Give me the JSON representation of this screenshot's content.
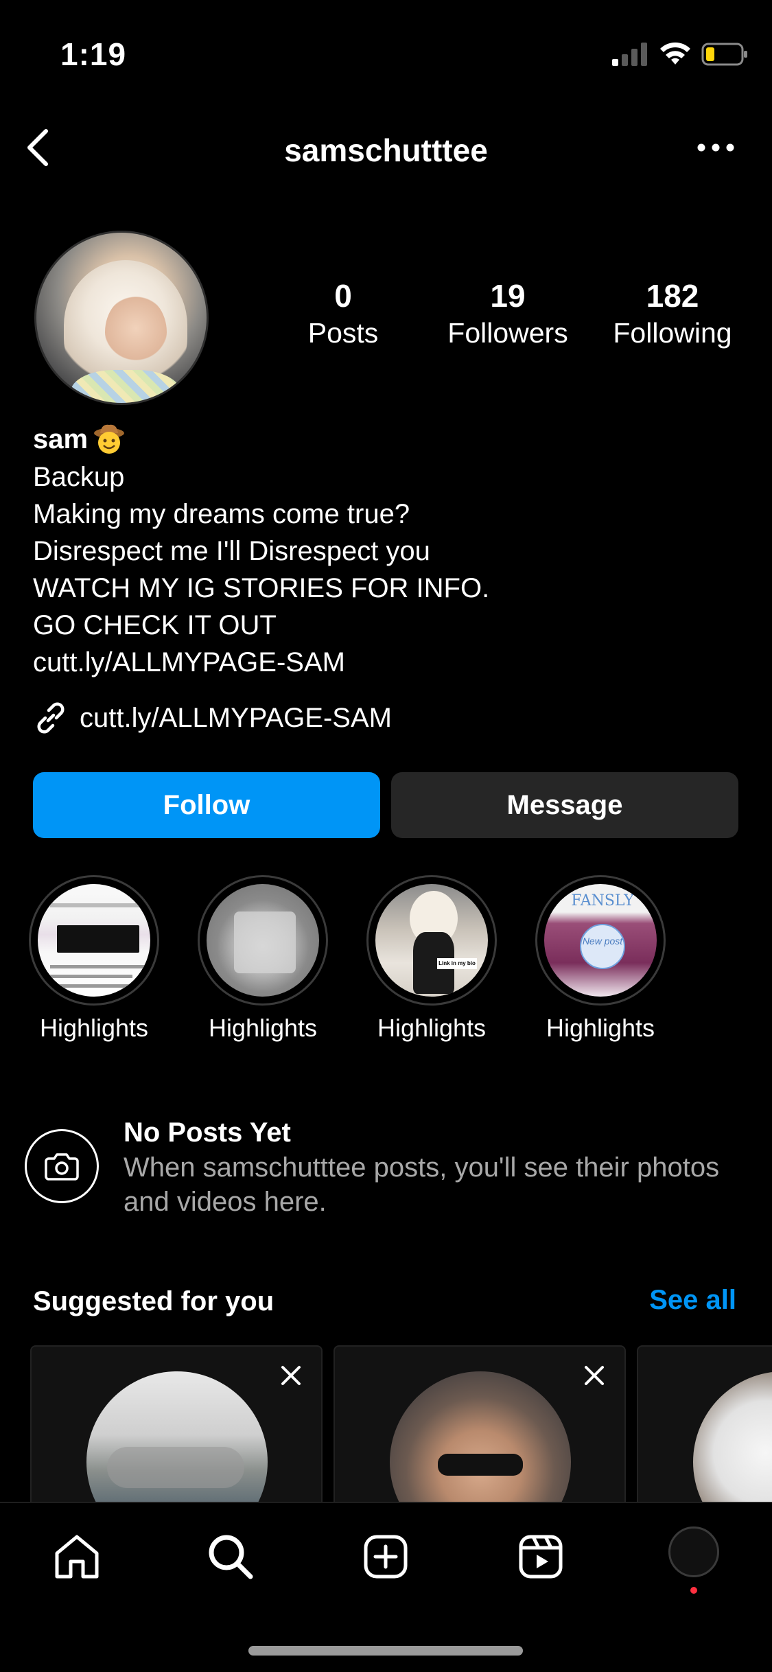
{
  "status_bar": {
    "time": "1:19"
  },
  "nav": {
    "username": "samschutttee"
  },
  "profile": {
    "stats": [
      {
        "count": "0",
        "label": "Posts"
      },
      {
        "count": "19",
        "label": "Followers"
      },
      {
        "count": "182",
        "label": "Following"
      }
    ],
    "name": "sam",
    "bio_lines": [
      "Backup",
      "Making my dreams come true?",
      "Disrespect me I'll Disrespect you",
      "WATCH MY IG STORIES FOR INFO.",
      "GO CHECK IT OUT",
      "cutt.ly/ALLMYPAGE-SAM"
    ],
    "link": "cutt.ly/ALLMYPAGE-SAM"
  },
  "actions": {
    "follow_label": "Follow",
    "message_label": "Message"
  },
  "highlights": [
    {
      "label": "Highlights"
    },
    {
      "label": "Highlights"
    },
    {
      "label": "Highlights"
    },
    {
      "label": "Highlights"
    }
  ],
  "highlight_text": {
    "link_in_bio": "Link in my bio",
    "fansly": "FANSLY",
    "new_post": "New post"
  },
  "no_posts": {
    "title": "No Posts Yet",
    "text": "When samschutttee posts, you'll see their photos and videos here."
  },
  "suggested": {
    "title": "Suggested for you",
    "see_all": "See all"
  },
  "colors": {
    "accent": "#0095f6",
    "background": "#000000",
    "secondary_button": "#262626",
    "notification_dot": "#ff3040"
  }
}
